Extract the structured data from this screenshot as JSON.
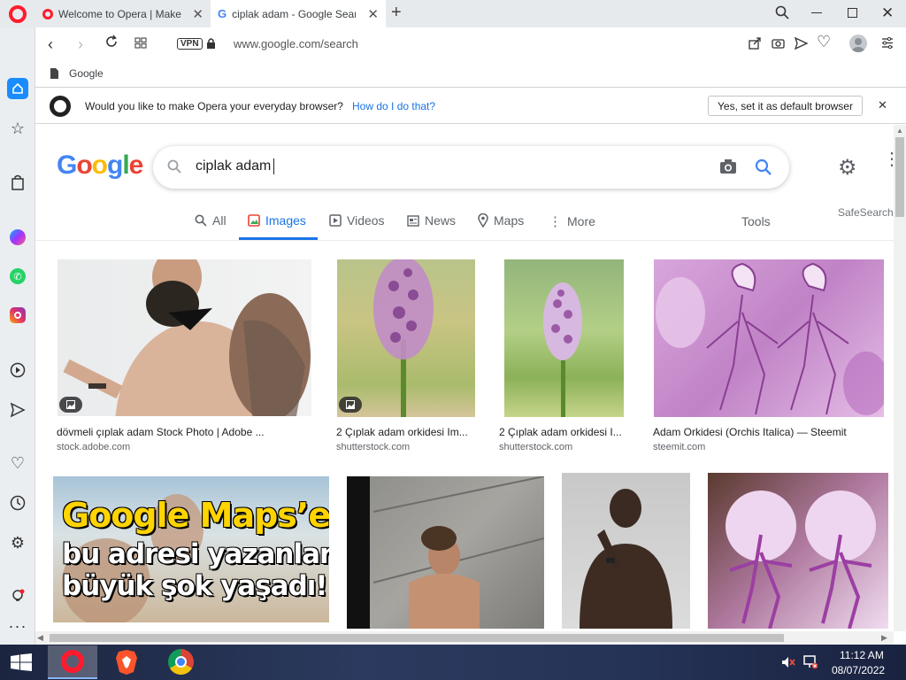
{
  "browser": {
    "tabs": [
      {
        "title": "Welcome to Opera | Make"
      },
      {
        "title": "ciplak adam - Google Sear"
      }
    ],
    "url": "www.google.com/search",
    "vpn_label": "VPN",
    "bookmark": "Google"
  },
  "infobar": {
    "message": "Would you like to make Opera your everyday browser?",
    "link": "How do I do that?",
    "button": "Yes, set it as default browser"
  },
  "google": {
    "query": "ciplak adam",
    "tabs": {
      "all": "All",
      "images": "Images",
      "videos": "Videos",
      "news": "News",
      "maps": "Maps",
      "more": "More"
    },
    "tools": "Tools",
    "safesearch": "SafeSearch"
  },
  "results": [
    {
      "caption": "dövmeli çıplak adam Stock Photo | Adobe ...",
      "source": "stock.adobe.com"
    },
    {
      "caption": "2 Çıplak adam orkidesi Im...",
      "source": "shutterstock.com"
    },
    {
      "caption": "2 Çıplak adam orkidesi I...",
      "source": "shutterstock.com"
    },
    {
      "caption": "Adam Orkidesi (Orchis Italica) — Steemit",
      "source": "steemit.com"
    }
  ],
  "banner": {
    "line1": "Google Maps’e",
    "line2": "bu adresi yazanlar",
    "line3": "büyük şok yaşadı!"
  },
  "taskbar": {
    "time": "11:12 AM",
    "date": "08/07/2022"
  },
  "colors": {
    "google_blue": "#1a73e8",
    "opera_red": "#ff1b2d"
  }
}
